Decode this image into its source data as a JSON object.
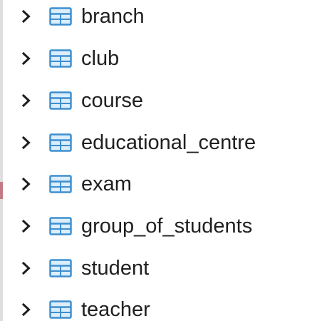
{
  "accent_color": "#3e8fcf",
  "icon_fill": "#dceefb",
  "tree": {
    "expander_icon": "chevron-right-icon",
    "item_icon": "table-icon",
    "items": [
      {
        "label": "branch"
      },
      {
        "label": "club"
      },
      {
        "label": "course"
      },
      {
        "label": "educational_centre"
      },
      {
        "label": "exam"
      },
      {
        "label": "group_of_students"
      },
      {
        "label": "student"
      },
      {
        "label": "teacher"
      }
    ]
  }
}
